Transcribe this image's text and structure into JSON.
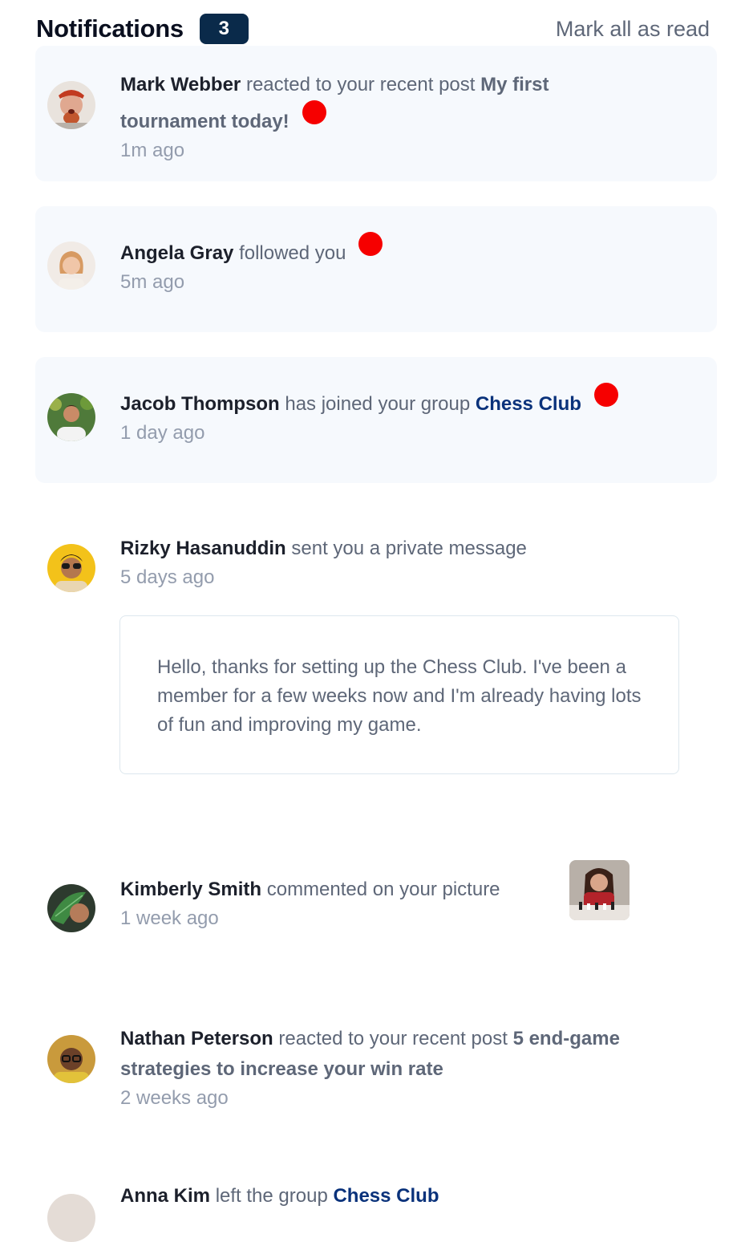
{
  "header": {
    "title": "Notifications",
    "unread_count": "3",
    "mark_all": "Mark all as read"
  },
  "notifications": [
    {
      "name": "Mark Webber",
      "action": "reacted to your recent post",
      "post": "My first tournament today!",
      "time": "1m ago",
      "unread": true
    },
    {
      "name": "Angela Gray",
      "action": "followed you",
      "time": "5m ago",
      "unread": true
    },
    {
      "name": "Jacob Thompson",
      "action": "has joined your group",
      "group": "Chess Club",
      "time": "1 day ago",
      "unread": true
    },
    {
      "name": "Rizky Hasanuddin",
      "action": "sent you a private message",
      "time": "5 days ago",
      "message": "Hello, thanks for setting up the Chess Club. I've been a member for a few weeks now and I'm already having lots of fun and improving my game.",
      "unread": false
    },
    {
      "name": "Kimberly Smith",
      "action": "commented on your picture",
      "time": "1 week ago",
      "unread": false
    },
    {
      "name": "Nathan Peterson",
      "action": "reacted to your recent post",
      "post": "5 end-game strategies to increase your win rate",
      "time": "2 weeks ago",
      "unread": false
    },
    {
      "name": "Anna Kim",
      "action": "left the group",
      "group": "Chess Club",
      "unread": false
    }
  ],
  "colors": {
    "unread_dot": "#f60000",
    "unread_bg": "#f6f9fd",
    "badge_bg": "#0a2a4a",
    "group_link": "#0a327b"
  }
}
